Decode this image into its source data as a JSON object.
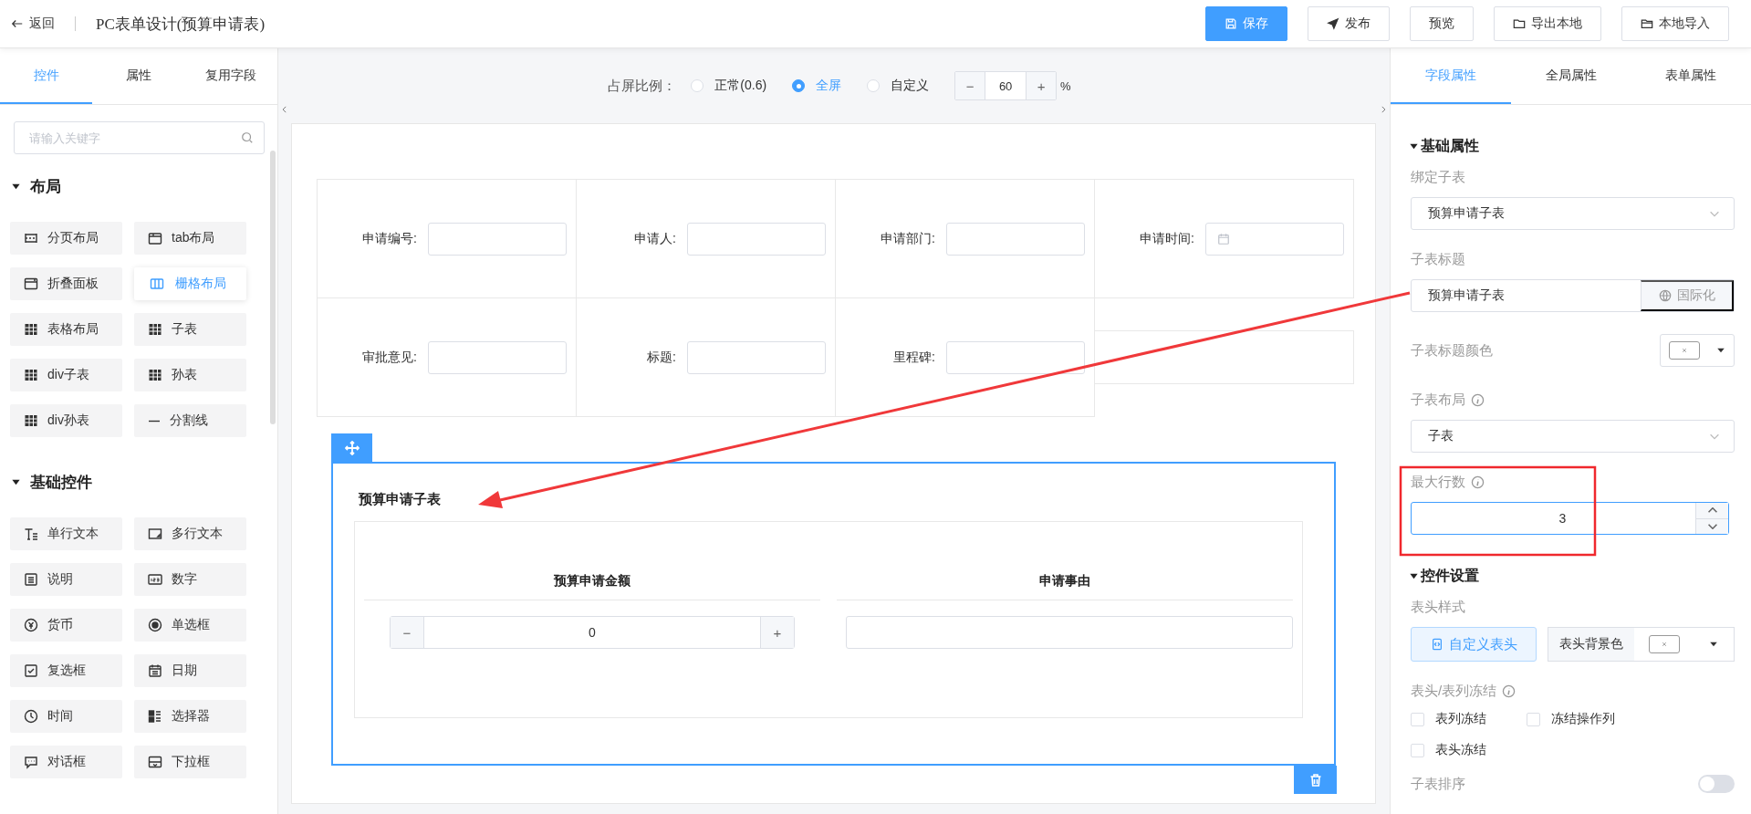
{
  "header": {
    "back": "返回",
    "title": "PC表单设计(预算申请表)",
    "actions": [
      {
        "label": "保存",
        "primary": true
      },
      {
        "label": "发布",
        "primary": false
      },
      {
        "label": "预览",
        "primary": false
      },
      {
        "label": "导出本地",
        "primary": false
      },
      {
        "label": "本地导入",
        "primary": false
      }
    ]
  },
  "left_panel": {
    "tabs": [
      {
        "label": "控件",
        "selected": true
      },
      {
        "label": "属性",
        "selected": false
      },
      {
        "label": "复用字段",
        "selected": false
      }
    ],
    "search": {
      "placeholder": "请输入关键字"
    },
    "groups": [
      {
        "title": "布局",
        "expanded": true,
        "items": [
          {
            "label": "分页布局",
            "selected": false
          },
          {
            "label": "tab布局",
            "selected": false
          },
          {
            "label": "折叠面板",
            "selected": false
          },
          {
            "label": "栅格布局",
            "selected": true
          },
          {
            "label": "表格布局",
            "selected": false
          },
          {
            "label": "子表",
            "selected": false
          },
          {
            "label": "div子表",
            "selected": false
          },
          {
            "label": "孙表",
            "selected": false
          },
          {
            "label": "div孙表",
            "selected": false
          },
          {
            "label": "分割线",
            "selected": false
          }
        ]
      },
      {
        "title": "基础控件",
        "expanded": true,
        "items": [
          {
            "label": "单行文本",
            "selected": false
          },
          {
            "label": "多行文本",
            "selected": false
          },
          {
            "label": "说明",
            "selected": false
          },
          {
            "label": "数字",
            "selected": false
          },
          {
            "label": "货币",
            "selected": false
          },
          {
            "label": "单选框",
            "selected": false
          },
          {
            "label": "复选框",
            "selected": false
          },
          {
            "label": "日期",
            "selected": false
          },
          {
            "label": "时间",
            "selected": false
          },
          {
            "label": "选择器",
            "selected": false
          },
          {
            "label": "对话框",
            "selected": false
          },
          {
            "label": "下拉框",
            "selected": false
          }
        ]
      }
    ]
  },
  "ratio": {
    "label": "占屏比例：",
    "options": [
      {
        "label": "正常(0.6)",
        "selected": false
      },
      {
        "label": "全屏",
        "selected": true
      },
      {
        "label": "自定义",
        "selected": false
      }
    ],
    "stepper": {
      "minus": "−",
      "value": "60",
      "plus": "+",
      "unit": "%"
    }
  },
  "form": {
    "rows": [
      [
        {
          "kind": "text",
          "label": "申请编号:"
        },
        {
          "kind": "text",
          "label": "申请人:"
        },
        {
          "kind": "text",
          "label": "申请部门:"
        },
        {
          "kind": "date",
          "label": "申请时间:"
        }
      ],
      [
        {
          "kind": "text",
          "label": "审批意见:"
        },
        {
          "kind": "text",
          "label": "标题:"
        },
        {
          "kind": "text",
          "label": "里程碑:"
        },
        {
          "kind": "empty"
        }
      ]
    ]
  },
  "subtable": {
    "title": "预算申请子表",
    "columns": [
      {
        "header": "预算申请金额",
        "kind": "number",
        "minus": "−",
        "value": "0",
        "plus": "+"
      },
      {
        "header": "申请事由",
        "kind": "text"
      }
    ]
  },
  "right_panel": {
    "tabs": [
      {
        "label": "字段属性",
        "selected": true
      },
      {
        "label": "全局属性",
        "selected": false
      },
      {
        "label": "表单属性",
        "selected": false
      }
    ],
    "sections": [
      {
        "title": "基础属性",
        "expanded": true,
        "fields": [
          {
            "kind": "select",
            "label": "绑定子表",
            "info": false,
            "value": "预算申请子表"
          },
          {
            "kind": "input-addon",
            "label": "子表标题",
            "info": false,
            "value": "预算申请子表",
            "addon": "国际化"
          },
          {
            "kind": "color",
            "label": "子表标题颜色",
            "info": false
          },
          {
            "kind": "select",
            "label": "子表布局",
            "info": true,
            "value": "子表"
          },
          {
            "kind": "number",
            "label": "最大行数",
            "info": true,
            "value": "3"
          }
        ]
      },
      {
        "title": "控件设置",
        "expanded": true,
        "fields": [
          {
            "kind": "header-style",
            "label": "表头样式",
            "info": false,
            "button": "自定义表头",
            "color_label": "表头背景色"
          },
          {
            "kind": "checkboxes",
            "label": "表头/表列冻结",
            "info": true,
            "options": [
              {
                "label": "表列冻结",
                "checked": false
              },
              {
                "label": "冻结操作列",
                "checked": false
              },
              {
                "label": "表头冻结",
                "checked": false
              }
            ]
          },
          {
            "kind": "switch",
            "label": "子表排序",
            "info": false,
            "on": false
          }
        ]
      }
    ]
  }
}
